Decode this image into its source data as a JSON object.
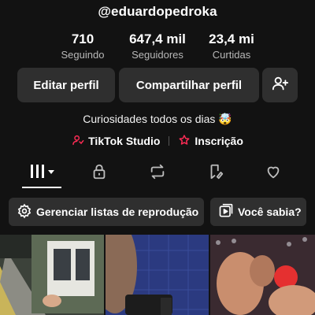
{
  "profile": {
    "username": "@eduardopedroka",
    "stats": [
      {
        "value": "710",
        "label": "Seguindo"
      },
      {
        "value": "647,4 mil",
        "label": "Seguidores"
      },
      {
        "value": "23,4 mi",
        "label": "Curtidas"
      }
    ],
    "bio": "Curiosidades todos os dias 🤯",
    "links": [
      {
        "label": "TikTok Studio",
        "icon": "person-link-icon",
        "color": "#fe2c55"
      },
      {
        "label": "Inscrição",
        "icon": "subscription-star-icon",
        "color": "#fe2c55"
      }
    ]
  },
  "actions": {
    "edit_label": "Editar perfil",
    "share_label": "Compartilhar perfil",
    "add_friend_icon": "add-person-icon"
  },
  "tabs": [
    {
      "icon": "grid-icon",
      "active": true
    },
    {
      "icon": "lock-icon",
      "active": false
    },
    {
      "icon": "repost-icon",
      "active": false
    },
    {
      "icon": "favorites-icon",
      "active": false
    },
    {
      "icon": "heart-icon",
      "active": false
    }
  ],
  "chips": {
    "playlists_label": "Gerenciar listas de reprodução",
    "know_label": "Você sabia?"
  },
  "colors": {
    "background": "#121212",
    "button": "#2f2f2f",
    "accent": "#fe2c55"
  }
}
